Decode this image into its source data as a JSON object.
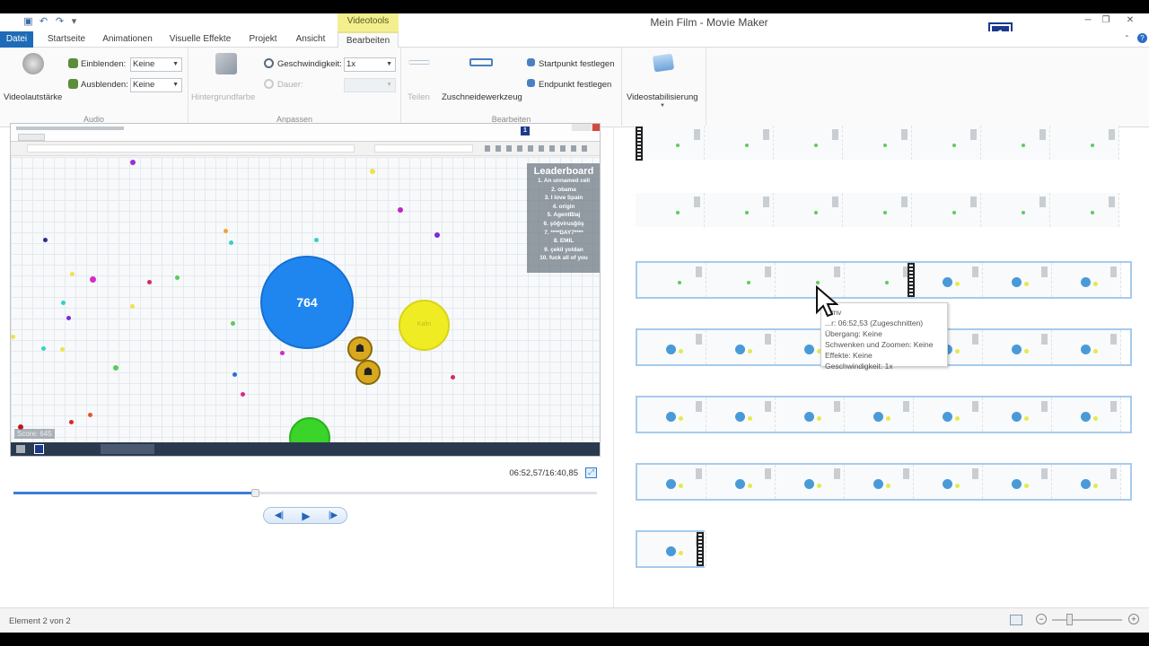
{
  "titlebar": {
    "app_title": "Mein Film - Movie Maker",
    "context_tab": "Videotools",
    "badge": "1"
  },
  "tabs": [
    "Datei",
    "Startseite",
    "Animationen",
    "Visuelle Effekte",
    "Projekt",
    "Ansicht",
    "Bearbeiten"
  ],
  "ribbon": {
    "audio": {
      "label": "Audio",
      "volume_label": "Videolautstärke",
      "fade_in_label": "Einblenden:",
      "fade_in_value": "Keine",
      "fade_out_label": "Ausblenden:",
      "fade_out_value": "Keine"
    },
    "adjust": {
      "label": "Anpassen",
      "bg_color_label": "Hintergrundfarbe",
      "speed_label": "Geschwindigkeit:",
      "speed_value": "1x",
      "duration_label": "Dauer:"
    },
    "edit": {
      "label": "Bearbeiten",
      "split_label": "Teilen",
      "trim_label": "Zuschneidewerkzeug",
      "start_label": "Startpunkt festlegen",
      "end_label": "Endpunkt festlegen"
    },
    "stabilize_label": "Videostabilisierung"
  },
  "preview": {
    "leaderboard_title": "Leaderboard",
    "leaderboard": [
      "1. An unnamed cell",
      "2. obama",
      "3. I love Spain",
      "4. origin",
      "5. AgentBlaj",
      "6. şöğvirusğöş",
      "7. ****DAY7****",
      "8. EMIL",
      "9. çekil yoldan",
      "10. fuck all of you"
    ],
    "big_cell_label": "764",
    "score_label": "Score: 645",
    "inner_badge": "1",
    "timecode": "06:52,57/16:40,85",
    "playback_progress": 0.416
  },
  "tooltip": {
    "lines": [
      "...mv",
      "...r: 06:52,53 (Zugeschnitten)",
      "Übergang: Keine",
      "Schwenken und Zoomen: Keine",
      "Effekte: Keine",
      "Geschwindigkeit: 1x"
    ]
  },
  "status": {
    "text": "Element 2 von 2"
  },
  "colors": {
    "accent": "#1e6bb8",
    "context_tab": "#f3ef8e",
    "selected_track": "#a6cbee",
    "big_cell": "#1f86f0"
  }
}
